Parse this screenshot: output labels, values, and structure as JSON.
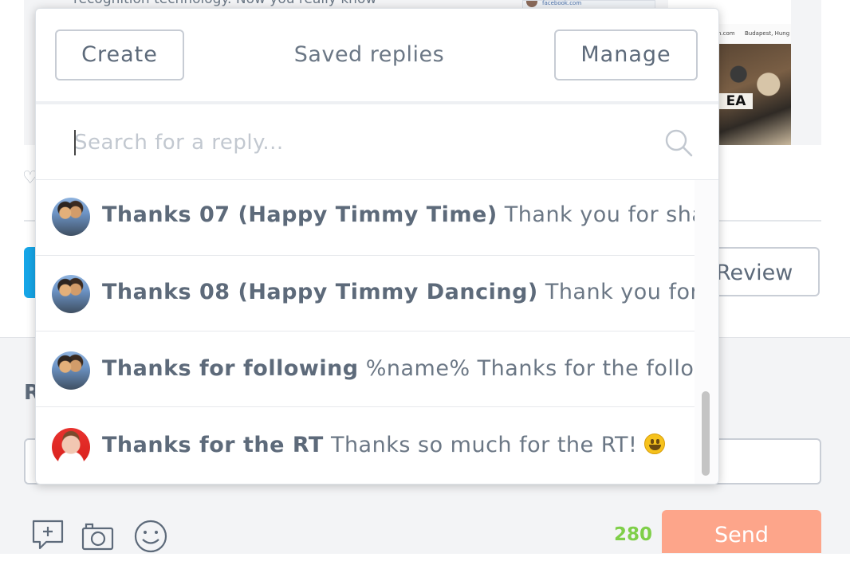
{
  "background": {
    "snippet": "recognition technology. Now you really know",
    "thumb_a_source": "facebook.com",
    "thumb_b_left": "n.com",
    "thumb_b_location": "Budapest, Hung",
    "thumb_b_overlay": "EA",
    "review_button": "Review",
    "reply_heading_letter": "R",
    "char_count": "280",
    "send_button": "Send"
  },
  "popover": {
    "title": "Saved replies",
    "create_button": "Create",
    "manage_button": "Manage",
    "search_placeholder": "Search for a reply..."
  },
  "replies": [
    {
      "name": "Thanks 07 (Happy Timmy Time)",
      "body": "Thank you for sharing",
      "avatar": "group-photo"
    },
    {
      "name": "Thanks 08 (Happy Timmy Dancing)",
      "body": "Thank you for shar",
      "avatar": "group-photo"
    },
    {
      "name": "Thanks for following",
      "body": "%name% Thanks for the follow! :-",
      "avatar": "group-photo"
    },
    {
      "name": "Thanks for the RT",
      "body": "Thanks so much for the RT!",
      "avatar": "person-red-bg",
      "emoji": "grinning-face"
    }
  ],
  "colors": {
    "accent_blue": "#16a6e8",
    "send_orange": "#fda58a",
    "count_green": "#7fcf49",
    "text": "#5d6a7a"
  }
}
